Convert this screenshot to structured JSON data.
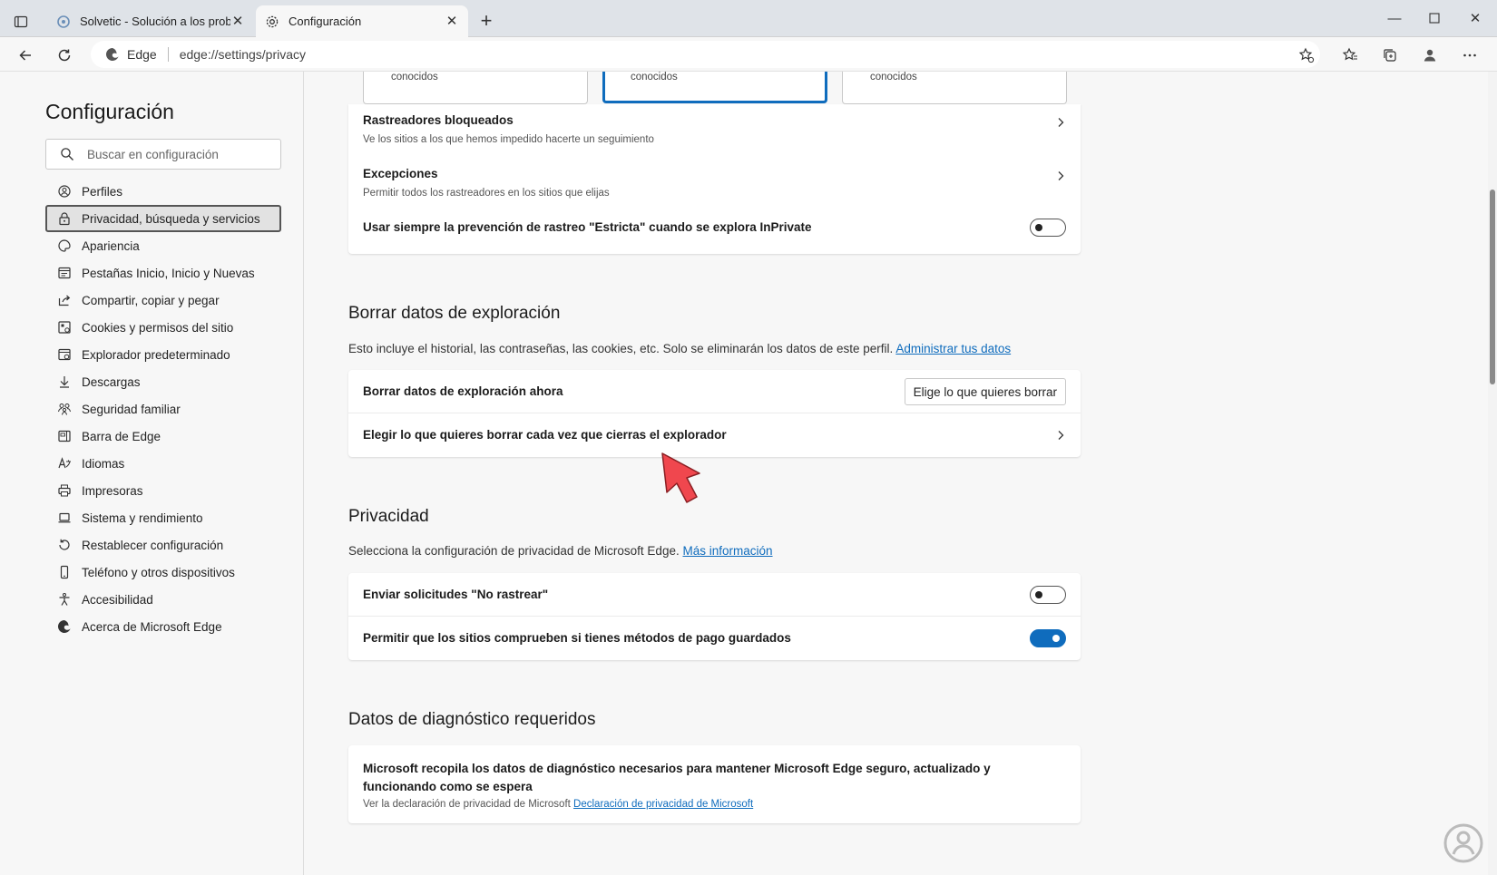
{
  "browser": {
    "tabs": [
      {
        "title": "Solvetic - Solución a los problem",
        "active": false
      },
      {
        "title": "Configuración",
        "active": true
      }
    ],
    "address": {
      "site_label": "Edge",
      "url": "edge://settings/privacy"
    }
  },
  "sidebar": {
    "title": "Configuración",
    "search_placeholder": "Buscar en configuración",
    "items": [
      {
        "label": "Perfiles",
        "icon": "profile-icon"
      },
      {
        "label": "Privacidad, búsqueda y servicios",
        "icon": "lock-icon",
        "selected": true
      },
      {
        "label": "Apariencia",
        "icon": "palette-icon"
      },
      {
        "label": "Pestañas Inicio, Inicio y Nuevas",
        "icon": "tabs-icon"
      },
      {
        "label": "Compartir, copiar y pegar",
        "icon": "share-icon"
      },
      {
        "label": "Cookies y permisos del sitio",
        "icon": "cookies-icon"
      },
      {
        "label": "Explorador predeterminado",
        "icon": "browser-icon"
      },
      {
        "label": "Descargas",
        "icon": "download-icon"
      },
      {
        "label": "Seguridad familiar",
        "icon": "family-icon"
      },
      {
        "label": "Barra de Edge",
        "icon": "sidebar-icon"
      },
      {
        "label": "Idiomas",
        "icon": "language-icon"
      },
      {
        "label": "Impresoras",
        "icon": "printer-icon"
      },
      {
        "label": "Sistema y rendimiento",
        "icon": "laptop-icon"
      },
      {
        "label": "Restablecer configuración",
        "icon": "reset-icon"
      },
      {
        "label": "Teléfono y otros dispositivos",
        "icon": "phone-icon"
      },
      {
        "label": "Accesibilidad",
        "icon": "accessibility-icon"
      },
      {
        "label": "Acerca de Microsoft Edge",
        "icon": "edge-icon"
      }
    ]
  },
  "tracking": {
    "options": [
      {
        "label": "conocidos",
        "selected": false
      },
      {
        "label": "conocidos",
        "selected": true
      },
      {
        "label": "conocidos",
        "selected": false
      }
    ],
    "blocked_title": "Rastreadores bloqueados",
    "blocked_sub": "Ve los sitios a los que hemos impedido hacerte un seguimiento",
    "exceptions_title": "Excepciones",
    "exceptions_sub": "Permitir todos los rastreadores en los sitios que elijas",
    "strict_inprivate": "Usar siempre la prevención de rastreo \"Estricta\" cuando se explora InPrivate",
    "strict_inprivate_on": false
  },
  "clear_data": {
    "title": "Borrar datos de exploración",
    "desc": "Esto incluye el historial, las contraseñas, las cookies, etc. Solo se eliminarán los datos de este perfil.",
    "desc_link": "Administrar tus datos",
    "now_label": "Borrar datos de exploración ahora",
    "now_button": "Elige lo que quieres borrar",
    "on_close_label": "Elegir lo que quieres borrar cada vez que cierras el explorador"
  },
  "privacy": {
    "title": "Privacidad",
    "desc": "Selecciona la configuración de privacidad de Microsoft Edge.",
    "desc_link": "Más información",
    "dnt_label": "Enviar solicitudes \"No rastrear\"",
    "dnt_on": false,
    "payment_label": "Permitir que los sitios comprueben si tienes métodos de pago guardados",
    "payment_on": true
  },
  "diagnostics": {
    "title": "Datos de diagnóstico requeridos",
    "body": "Microsoft recopila los datos de diagnóstico necesarios para mantener Microsoft Edge seguro, actualizado y funcionando como se espera",
    "footnote": "Ver la declaración de privacidad de Microsoft",
    "footnote_link": "Declaración de privacidad de Microsoft"
  },
  "colors": {
    "accent": "#0f6cbd",
    "arrow": "#f0474e"
  }
}
